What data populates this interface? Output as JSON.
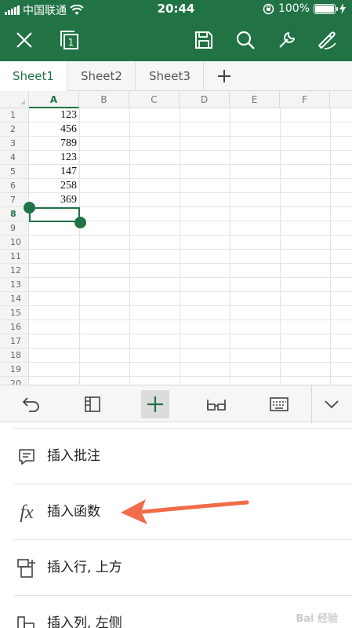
{
  "status_bar": {
    "carrier": "中国联通",
    "time": "20:44",
    "battery": "100%"
  },
  "toolbar": {
    "icons": [
      "close-icon",
      "window-switch-icon",
      "save-icon",
      "search-icon",
      "tools-icon",
      "pen-icon"
    ],
    "window_count": "1"
  },
  "sheet_tabs": [
    "Sheet1",
    "Sheet2",
    "Sheet3"
  ],
  "grid": {
    "columns": [
      "A",
      "B",
      "C",
      "D",
      "E",
      "F"
    ],
    "rows": [
      "1",
      "2",
      "3",
      "4",
      "5",
      "6",
      "7",
      "8",
      "9",
      "10",
      "11",
      "12",
      "13",
      "14",
      "15",
      "16",
      "17",
      "18",
      "19",
      "20"
    ],
    "column_a_values": [
      "123",
      "456",
      "789",
      "123",
      "147",
      "258",
      "369"
    ],
    "active_row": "8",
    "active_column": "A"
  },
  "action_bar": {
    "icons": [
      "undo-icon",
      "layout-icon",
      "insert-plus-icon",
      "view-glasses-icon",
      "keyboard-icon",
      "chevron-down-icon"
    ]
  },
  "menu": {
    "items": [
      {
        "label": "插入批注",
        "icon": "comment-icon"
      },
      {
        "label": "插入函数",
        "icon": "function-icon",
        "glyph": "fx"
      },
      {
        "label": "插入行, 上方",
        "icon": "insert-row-icon"
      },
      {
        "label": "插入列, 左侧",
        "icon": "insert-column-icon"
      }
    ]
  },
  "colors": {
    "brand": "#217346",
    "annotation_arrow": "#f26b4a"
  }
}
